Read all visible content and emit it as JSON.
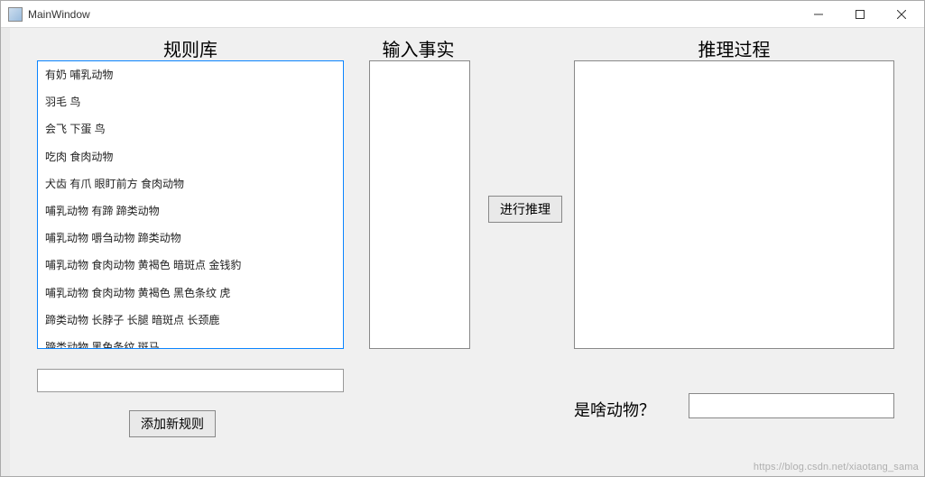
{
  "window": {
    "title": "MainWindow"
  },
  "headings": {
    "rules": "规则库",
    "facts": "输入事实",
    "process": "推理过程"
  },
  "rules": {
    "items": [
      "有奶 哺乳动物",
      "羽毛 鸟",
      "会飞 下蛋 鸟",
      "吃肉 食肉动物",
      "犬齿 有爪 眼盯前方 食肉动物",
      "哺乳动物 有蹄 蹄类动物",
      "哺乳动物 嚼刍动物 蹄类动物",
      "哺乳动物 食肉动物 黄褐色 暗斑点 金钱豹",
      "哺乳动物 食肉动物 黄褐色 黑色条纹 虎",
      "蹄类动物 长脖子 长腿 暗斑点 长颈鹿",
      "蹄类动物 黑色条纹 斑马"
    ]
  },
  "buttons": {
    "add_rule": "添加新规则",
    "infer": "进行推理"
  },
  "inputs": {
    "new_rule": "",
    "facts": "",
    "process": "",
    "result": ""
  },
  "result_label": "是啥动物？",
  "watermark": "https://blog.csdn.net/xiaotang_sama"
}
